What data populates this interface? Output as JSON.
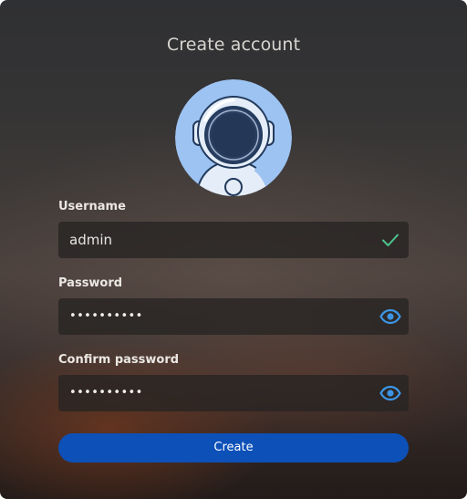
{
  "dialog": {
    "title": "Create account"
  },
  "avatar": {
    "icon": "astronaut-avatar-icon",
    "background": "#9dc3f2"
  },
  "username": {
    "label": "Username",
    "value": "admin",
    "status_icon": "checkmark-icon",
    "status_color": "#4ec48d"
  },
  "password": {
    "label": "Password",
    "value": "••••••••••",
    "reveal_icon": "eye-icon"
  },
  "confirm_password": {
    "label": "Confirm password",
    "value": "••••••••••",
    "reveal_icon": "eye-icon"
  },
  "actions": {
    "create_label": "Create"
  },
  "colors": {
    "accent": "#0d50b8",
    "eye_icon": "#3d95e6"
  }
}
